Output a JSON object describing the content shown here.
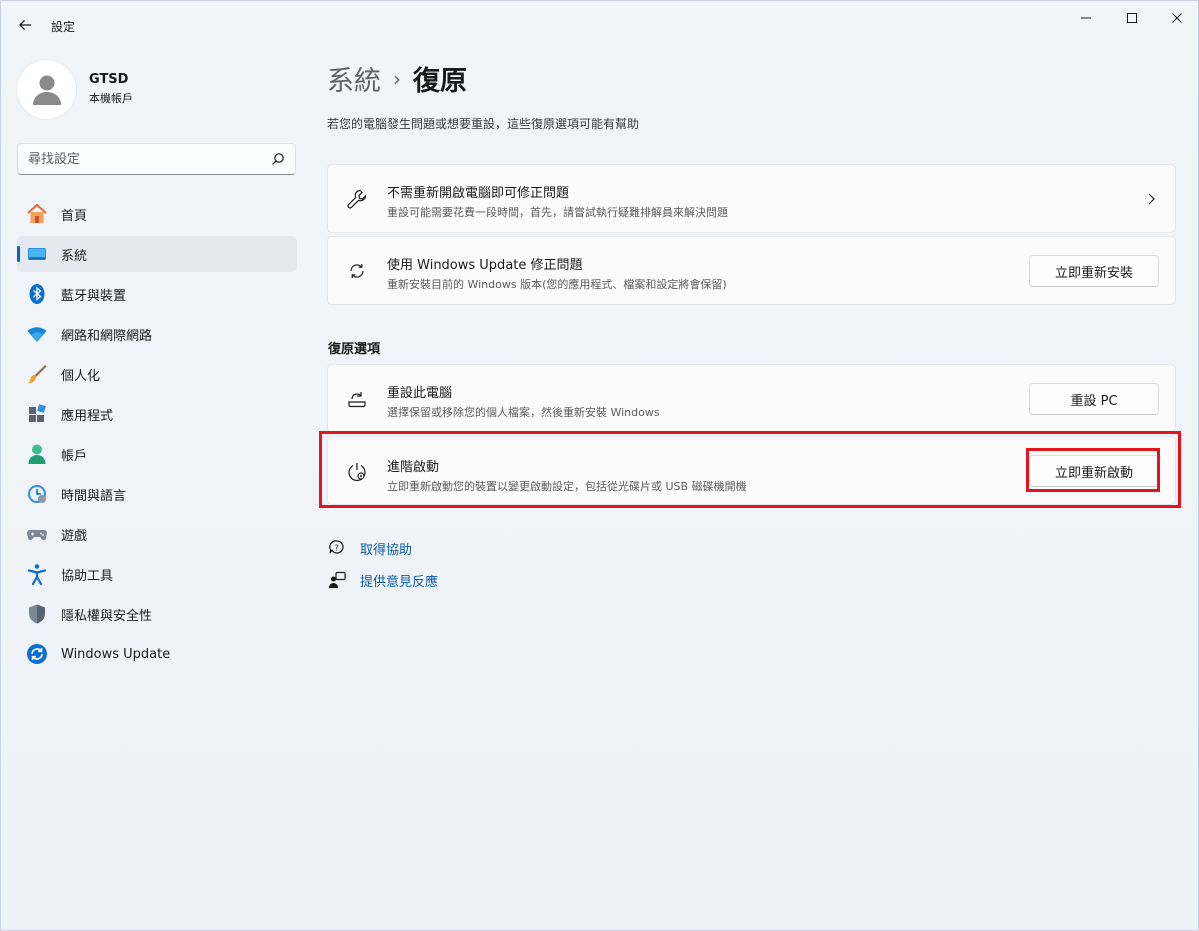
{
  "window": {
    "title": "設定"
  },
  "profile": {
    "name": "GTSD",
    "account_type": "本機帳戶"
  },
  "search": {
    "placeholder": "尋找設定"
  },
  "sidebar": {
    "items": [
      {
        "label": "首頁",
        "icon": "home-icon"
      },
      {
        "label": "系統",
        "icon": "system-icon",
        "active": true
      },
      {
        "label": "藍牙與裝置",
        "icon": "bluetooth-icon"
      },
      {
        "label": "網路和網際網路",
        "icon": "wifi-icon"
      },
      {
        "label": "個人化",
        "icon": "brush-icon"
      },
      {
        "label": "應用程式",
        "icon": "apps-icon"
      },
      {
        "label": "帳戶",
        "icon": "account-icon"
      },
      {
        "label": "時間與語言",
        "icon": "time-language-icon"
      },
      {
        "label": "遊戲",
        "icon": "gamepad-icon"
      },
      {
        "label": "協助工具",
        "icon": "accessibility-icon"
      },
      {
        "label": "隱私權與安全性",
        "icon": "shield-icon"
      },
      {
        "label": "Windows Update",
        "icon": "windows-update-icon"
      }
    ]
  },
  "main": {
    "breadcrumb_parent": "系統",
    "breadcrumb_separator": "›",
    "breadcrumb_current": "復原",
    "subtitle": "若您的電腦發生問題或想要重設，這些復原選項可能有幫助",
    "top_cards": [
      {
        "title": "不需重新開啟電腦即可修正問題",
        "desc": "重設可能需要花費一段時間，首先，請嘗試執行疑難排解員來解決問題",
        "icon": "wrench-icon"
      },
      {
        "title": "使用 Windows Update 修正問題",
        "desc": "重新安裝目前的 Windows 版本(您的應用程式、檔案和設定將會保留)",
        "button": "立即重新安裝",
        "icon": "sync-icon"
      }
    ],
    "section_title": "復原選項",
    "recovery_cards": [
      {
        "title": "重設此電腦",
        "desc": "選擇保留或移除您的個人檔案，然後重新安裝 Windows",
        "button": "重設 PC",
        "icon": "reset-pc-icon"
      },
      {
        "title": "進階啟動",
        "desc": "立即重新啟動您的裝置以變更啟動設定，包括從光碟片或 USB 磁碟機開機",
        "button": "立即重新啟動",
        "icon": "advanced-startup-icon"
      }
    ],
    "links": [
      {
        "label": "取得協助",
        "icon": "help-icon"
      },
      {
        "label": "提供意見反應",
        "icon": "feedback-icon"
      }
    ]
  },
  "colors": {
    "accent": "#0067c0",
    "highlight": "#e3141e",
    "link": "#0b5cad"
  }
}
